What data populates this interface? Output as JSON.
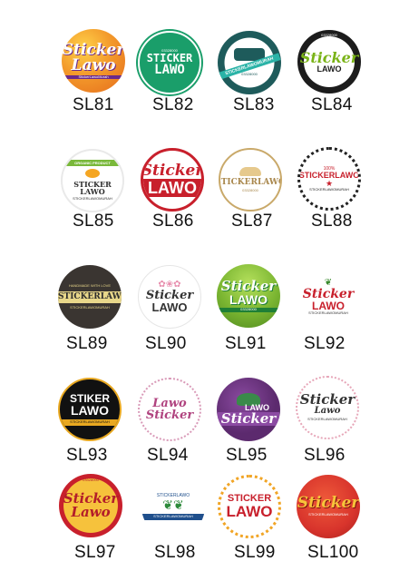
{
  "items": [
    {
      "code": "SL81",
      "brand": "Sticker",
      "brand2": "Lawo",
      "small": "StickerLawoMurah",
      "colors": {
        "bg": "#f39a2b",
        "text": "#ffffff",
        "accent": "#6a2a8c"
      }
    },
    {
      "code": "SL82",
      "brand": "STICKER",
      "brand2": "LAWO",
      "small": "03328000",
      "colors": {
        "bg": "#1a9e6a",
        "text": "#ffffff"
      }
    },
    {
      "code": "SL83",
      "brand": "STICKERLAWOMURAH",
      "brand2": "",
      "small": "03328000",
      "colors": {
        "bg": "#1e5b5b",
        "text": "#ffffff",
        "accent": "#2ab3a7"
      }
    },
    {
      "code": "SL84",
      "brand": "Sticker",
      "brand2": "LAWO",
      "small": "03328000",
      "colors": {
        "bg": "#1c1c1c",
        "text": "#7ab317",
        "ring": "#ffffff"
      }
    },
    {
      "code": "SL85",
      "brand": "STICKER LAWO",
      "brand2": "ORGANIC PRODUCT",
      "small": "STICKERLAWOMURAH",
      "colors": {
        "bg": "#ffffff",
        "text": "#2d2d2d",
        "accent": "#79b83a"
      }
    },
    {
      "code": "SL86",
      "brand": "Sticker",
      "brand2": "LAWO",
      "small": "",
      "colors": {
        "bg": "#ffffff",
        "text": "#c8202c",
        "ring": "#c8202c"
      }
    },
    {
      "code": "SL87",
      "brand": "STICKERLAWO",
      "brand2": "",
      "small": "03328000",
      "colors": {
        "bg": "#ffffff",
        "text": "#a9874c",
        "ring": "#c9a96a"
      }
    },
    {
      "code": "SL88",
      "brand": "STICKERLAWO",
      "brand2": "100%",
      "small": "STICKERLAWOMURAH",
      "colors": {
        "bg": "#ffffff",
        "text": "#c8202c",
        "ring": "#222222"
      }
    },
    {
      "code": "SL89",
      "brand": "STICKERLAWO",
      "brand2": "HANDMADE WITH LOVE",
      "small": "STICKERLAWOMURAH",
      "colors": {
        "bg": "#3a3531",
        "text": "#2d2d2d",
        "accent": "#e8d78a"
      }
    },
    {
      "code": "SL90",
      "brand": "Sticker",
      "brand2": "LAWO",
      "small": "",
      "colors": {
        "bg": "#ffffff",
        "text": "#333333",
        "accent": "#e88fae"
      }
    },
    {
      "code": "SL91",
      "brand": "Sticker",
      "brand2": "LAWO",
      "small": "03328000",
      "colors": {
        "bg": "#7ab531",
        "text": "#ffffff",
        "accent": "#1e7f36"
      }
    },
    {
      "code": "SL92",
      "brand": "Sticker",
      "brand2": "LAWO",
      "small": "STICKERLAWOMURAH",
      "colors": {
        "bg": "#ffffff",
        "text": "#c8202c",
        "accent": "#3a8a2e"
      }
    },
    {
      "code": "SL93",
      "brand": "STIKER",
      "brand2": "LAWO",
      "small": "STICKERLAWOMURAH",
      "colors": {
        "bg": "#111111",
        "text": "#ffffff",
        "accent": "#e8a821"
      }
    },
    {
      "code": "SL94",
      "brand": "Lawo",
      "brand2": "Sticker",
      "small": "",
      "colors": {
        "bg": "#ffffff",
        "text": "#b0437f",
        "ring": "#d99ab8"
      }
    },
    {
      "code": "SL95",
      "brand": "LAWO",
      "brand2": "Sticker",
      "small": "",
      "colors": {
        "bg": "#5c2a6e",
        "text": "#ffffff",
        "accent": "#3a8a4a"
      }
    },
    {
      "code": "SL96",
      "brand": "Sticker",
      "brand2": "Lawo",
      "small": "STICKERLAWOMURAH",
      "colors": {
        "bg": "#ffffff",
        "text": "#333333",
        "accent": "#e7a7b9"
      }
    },
    {
      "code": "SL97",
      "brand": "Sticker",
      "brand2": "Lawo",
      "small": "03328000",
      "colors": {
        "bg": "#f6c23c",
        "text": "#b31d2a",
        "ring": "#c8202c"
      }
    },
    {
      "code": "SL98",
      "brand": "STICKERLAWO",
      "brand2": "",
      "small": "STICKERLAWOMURAH",
      "colors": {
        "bg": "#ffffff",
        "text": "#1f4f8c",
        "accent": "#2c8a3a"
      }
    },
    {
      "code": "SL99",
      "brand": "STICKER",
      "brand2": "LAWO",
      "small": "",
      "colors": {
        "bg": "#ffffff",
        "text": "#c8202c",
        "ring": "#f1a526"
      }
    },
    {
      "code": "SL100",
      "brand": "Sticker",
      "brand2": "",
      "small": "STICKERLAWOMURAH",
      "colors": {
        "bg": "#d8342c",
        "text": "#f7c43a"
      }
    }
  ]
}
